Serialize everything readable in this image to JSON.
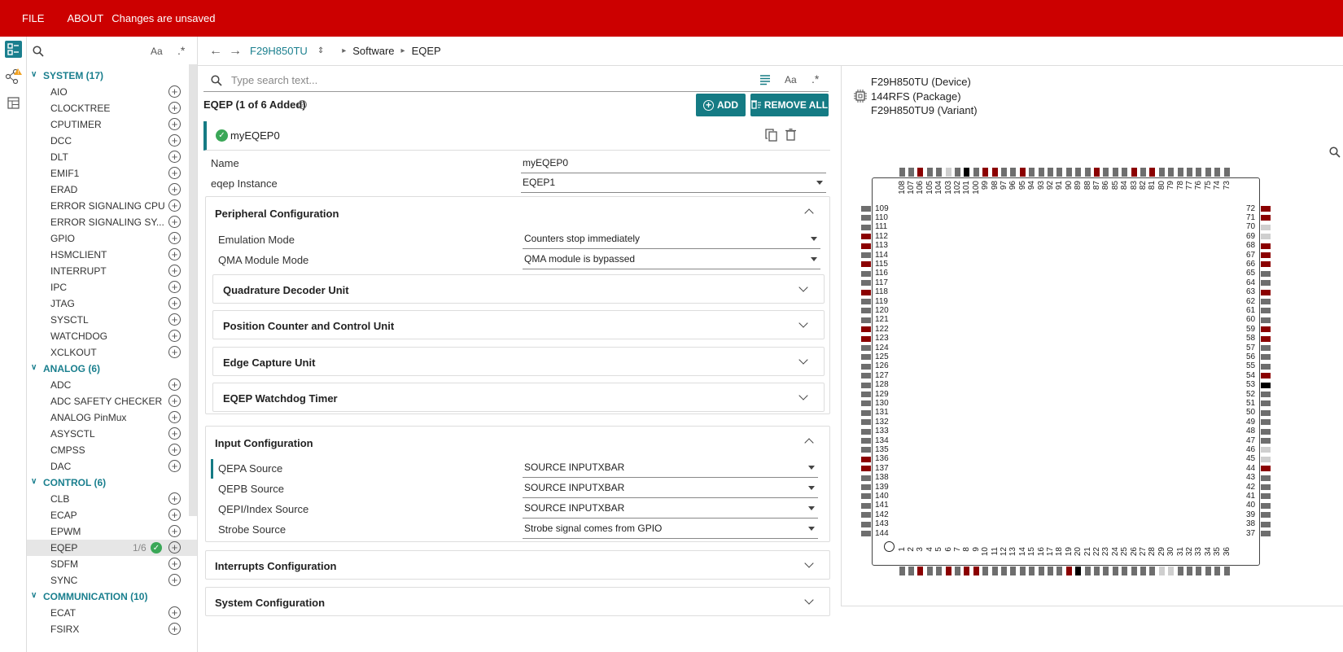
{
  "topbar": {
    "file": "FILE",
    "about": "ABOUT",
    "status": "Changes are unsaved"
  },
  "tree": {
    "categories": [
      {
        "label": "SYSTEM (17)",
        "items": [
          "AIO",
          "CLOCKTREE",
          "CPUTIMER",
          "DCC",
          "DLT",
          "EMIF1",
          "ERAD",
          "ERROR SIGNALING CPU",
          "ERROR SIGNALING SY...",
          "GPIO",
          "HSMCLIENT",
          "INTERRUPT",
          "IPC",
          "JTAG",
          "SYSCTL",
          "WATCHDOG",
          "XCLKOUT"
        ]
      },
      {
        "label": "ANALOG (6)",
        "items": [
          "ADC",
          "ADC SAFETY CHECKER",
          "ANALOG PinMux",
          "ASYSCTL",
          "CMPSS",
          "DAC"
        ]
      },
      {
        "label": "CONTROL (6)",
        "items": [
          "CLB",
          "ECAP",
          "EPWM",
          "EQEP",
          "SDFM",
          "SYNC"
        ]
      },
      {
        "label": "COMMUNICATION (10)",
        "items": [
          "ECAT",
          "FSIRX"
        ]
      }
    ],
    "selected_count": "1/6"
  },
  "breadcrumb": {
    "device": "F29H850TU",
    "software": "Software",
    "module": "EQEP"
  },
  "search": {
    "placeholder": "Type search text..."
  },
  "module": {
    "title": "EQEP (1 of 6 Added)",
    "add": "ADD",
    "remove_all": "REMOVE ALL",
    "instance_name": "myEQEP0"
  },
  "fields": {
    "name_label": "Name",
    "name_value": "myEQEP0",
    "instance_label": "eqep Instance",
    "instance_value": "EQEP1"
  },
  "peripheral": {
    "title": "Peripheral Configuration",
    "emu_label": "Emulation Mode",
    "emu_value": "Counters stop immediately",
    "qma_label": "QMA Module Mode",
    "qma_value": "QMA module is bypassed",
    "subs": [
      "Quadrature Decoder Unit",
      "Position Counter and Control Unit",
      "Edge Capture Unit",
      "EQEP Watchdog Timer"
    ]
  },
  "input": {
    "title": "Input Configuration",
    "rows": [
      {
        "label": "QEPA Source",
        "value": "SOURCE INPUTXBAR"
      },
      {
        "label": "QEPB Source",
        "value": "SOURCE INPUTXBAR"
      },
      {
        "label": "QEPI/Index Source",
        "value": "SOURCE INPUTXBAR"
      },
      {
        "label": "Strobe Source",
        "value": "Strobe signal comes from GPIO"
      }
    ]
  },
  "interrupts": {
    "title": "Interrupts Configuration"
  },
  "system": {
    "title": "System Configuration"
  },
  "package": {
    "device": "F29H850TU (Device)",
    "package": "144RFS (Package)",
    "variant": "F29H850TU9 (Variant)"
  },
  "pins": {
    "red": [
      3,
      6,
      8,
      9,
      19,
      44,
      54,
      58,
      59,
      63,
      66,
      67,
      68,
      71,
      72,
      81,
      83,
      87,
      95,
      98,
      99,
      106,
      112,
      113,
      115,
      118,
      122,
      123,
      136,
      137
    ],
    "black": [
      20,
      53,
      101
    ],
    "light": [
      29,
      30,
      45,
      46,
      69,
      70,
      103
    ]
  },
  "colors": {
    "topbar": "#cc0000",
    "accent": "#157b84",
    "ok": "#3aa757",
    "pin": "#6e6e6e",
    "pin_red": "#8b0000"
  }
}
